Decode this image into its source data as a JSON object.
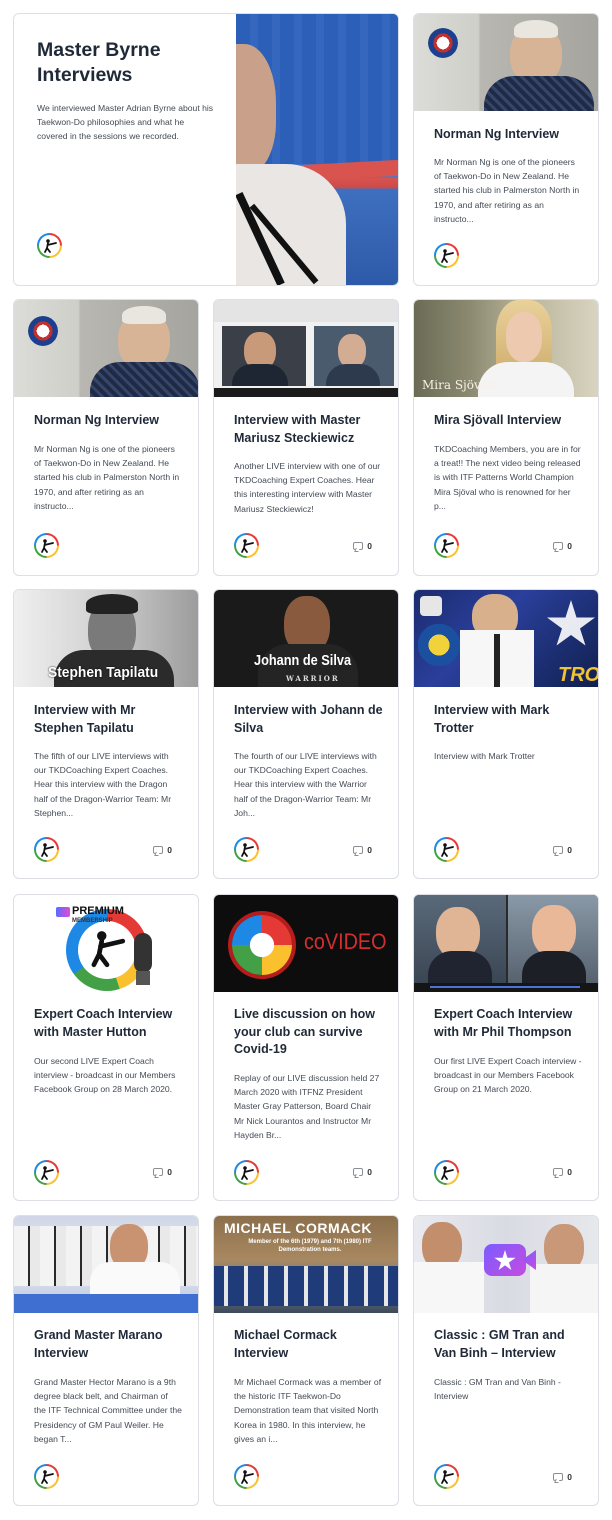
{
  "cards": [
    {
      "title": "Master Byrne Interviews",
      "excerpt": "We interviewed Master Adrian Byrne about his Taekwon-Do philosophies and what he covered in the sessions we recorded."
    },
    {
      "title": "Norman Ng Interview",
      "excerpt": "Mr Norman Ng is one of the pioneers of Taekwon-Do in New Zealand. He started his club in Palmerston North in 1970, and after retiring as an instructo..."
    },
    {
      "title": "Norman Ng Interview",
      "excerpt": "Mr Norman Ng is one of the pioneers of Taekwon-Do in New Zealand. He started his club in Palmerston North in 1970, and after retiring as an instructo..."
    },
    {
      "title": "Interview with Master Mariusz Steckiewicz",
      "excerpt": "Another LIVE interview with one of our TKDCoaching Expert Coaches. Hear this interesting interview with Master Mariusz Steckiewicz!",
      "comments": "0"
    },
    {
      "title": "Mira Sjövall Interview",
      "excerpt": "TKDCoaching Members, you are in for a treat!! The next video being released is with ITF Patterns World Champion Mira Sjöval who is renowned for her p...",
      "comments": "0",
      "thumb_text": "Mira Sjövall"
    },
    {
      "title": "Interview with Mr Stephen Tapilatu",
      "excerpt": "The fifth of our LIVE interviews with our TKDCoaching Expert Coaches. Hear this interview with the Dragon half of the Dragon-Warrior Team: Mr Stephen...",
      "comments": "0",
      "thumb_text": "Stephen Tapilatu"
    },
    {
      "title": "Interview with Johann de Silva",
      "excerpt": "The fourth of our LIVE interviews with our TKDCoaching Expert Coaches. Hear this interview with the Warrior half of the Dragon-Warrior Team: Mr  Joh...",
      "comments": "0",
      "thumb_text": "Johann de Silva",
      "thumb_sub": "WARRIOR"
    },
    {
      "title": "Interview with Mark Trotter",
      "excerpt": "Interview with Mark Trotter",
      "comments": "0",
      "thumb_text": "TRO"
    },
    {
      "title": "Expert Coach Interview with Master Hutton",
      "excerpt": "Our second LIVE Expert Coach interview - broadcast in our Members Facebook Group on 28 March 2020.",
      "comments": "0",
      "thumb_text": "PREMIUM",
      "thumb_sub": "MEMBERSHIP"
    },
    {
      "title": "Live discussion on how your club can survive Covid-19",
      "excerpt": "Replay of our LIVE discussion held 27 March 2020 with ITFNZ President Master Gray Patterson, Board Chair Mr Nick Lourantos and Instructor Mr Hayden Br...",
      "comments": "0",
      "thumb_text": "coVIDEO"
    },
    {
      "title": "Expert Coach Interview with Mr Phil Thompson",
      "excerpt": "Our first LIVE Expert Coach interview - broadcast in our Members Facebook Group on 21 March 2020.",
      "comments": "0"
    },
    {
      "title": "Grand Master Marano Interview",
      "excerpt": "Grand Master Hector Marano is a 9th degree black belt, and Chairman of the ITF Technical Committee under the Presidency of GM Paul Weiler. He began T..."
    },
    {
      "title": "Michael Cormack Interview",
      "excerpt": "Mr Michael Cormack was a member of the historic ITF Taekwon-Do Demonstration team that visited North Korea in 1980. In this interview, he gives an i...",
      "thumb_text": "MICHAEL CORMACK",
      "thumb_sub": "Member of the 6th (1979) and 7th (1980) ITF Demonstration teams."
    },
    {
      "title": "Classic : GM Tran and Van Binh – Interview",
      "excerpt": "Classic : GM Tran and Van Binh - Interview",
      "comments": "0"
    }
  ],
  "colors": {
    "accent_blue": "#1d4ed8",
    "card_border": "#dcdfe3",
    "title_text": "#1f2937"
  },
  "icons": [
    "taekwondo-kick-logo-icon",
    "comment-icon",
    "video-camera-star-icon"
  ]
}
